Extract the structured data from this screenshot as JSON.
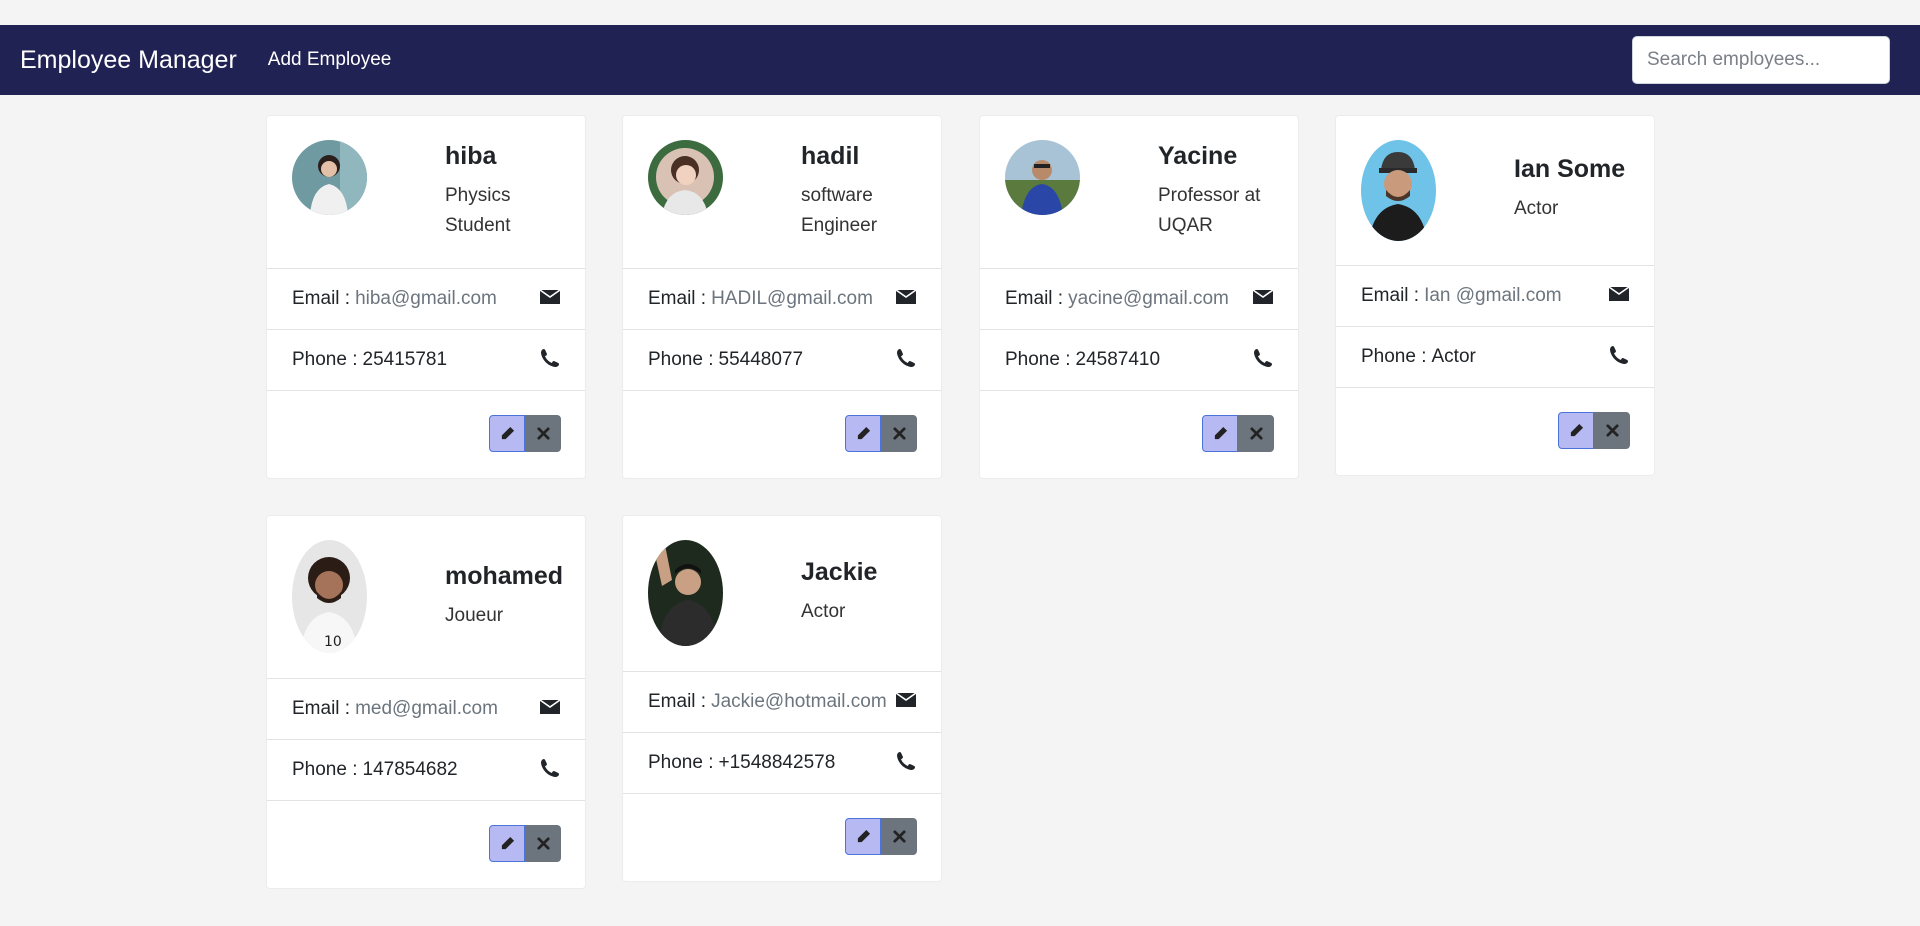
{
  "navbar": {
    "brand": "Employee Manager",
    "add_link": "Add Employee",
    "search_placeholder": "Search employees..."
  },
  "labels": {
    "email": "Email :",
    "phone": "Phone :"
  },
  "employees": [
    {
      "name": "hiba",
      "title": "Physics Student",
      "email": "hiba@gmail.com",
      "phone": "25415781"
    },
    {
      "name": "hadil",
      "title": "software Engineer",
      "email": "HADIL@gmail.com",
      "phone": "55448077"
    },
    {
      "name": "Yacine",
      "title": "Professor at UQAR",
      "email": "yacine@gmail.com",
      "phone": "24587410"
    },
    {
      "name": "Ian Some",
      "title": "Actor",
      "email": "Ian @gmail.com",
      "phone": "Actor"
    },
    {
      "name": "mohamed",
      "title": "Joueur",
      "email": "med@gmail.com",
      "phone": "147854682"
    },
    {
      "name": "Jackie",
      "title": "Actor",
      "email": "Jackie@hotmail.com",
      "phone": "+1548842578"
    }
  ],
  "icons": [
    "envelope-icon",
    "phone-icon",
    "pencil-icon",
    "times-icon"
  ],
  "colors": {
    "navbar": "#212254",
    "background": "#f4f4f4",
    "edit_button": "#b7b9f2",
    "delete_button": "#6c757d"
  }
}
